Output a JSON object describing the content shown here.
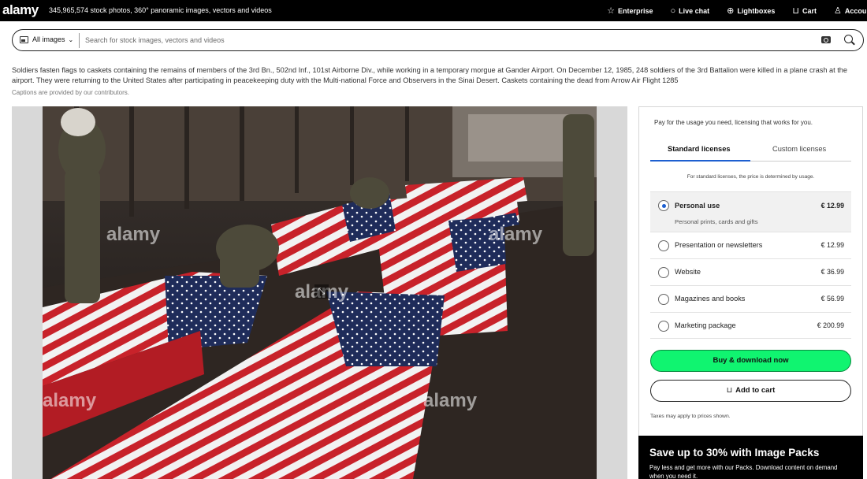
{
  "topbar": {
    "logo": "alamy",
    "stats": "345,965,574 stock photos, 360° panoramic images, vectors and videos",
    "nav": [
      {
        "label": "Enterprise",
        "icon": "star-icon"
      },
      {
        "label": "Live chat",
        "icon": "chat-icon"
      },
      {
        "label": "Lightboxes",
        "icon": "plus-circle-icon"
      },
      {
        "label": "Cart",
        "icon": "cart-icon"
      },
      {
        "label": "Account",
        "icon": "user-icon"
      }
    ]
  },
  "search": {
    "scope": "All images",
    "placeholder": "Search for stock images, vectors and videos"
  },
  "caption": {
    "text": "Soldiers fasten flags to caskets containing the remains of members of the 3rd Bn., 502nd Inf., 101st Airborne Div., while working in a temporary morgue at Gander Airport. On December 12, 1985, 248 soldiers of the 3rd Battalion were killed in a plane crash at the airport. They were returning to the United States after participating in peacekeeping duty with the Multi-national Force and Observers in the Sinai Desert. Caskets containing the dead from Arrow Air Flight 1285",
    "credit": "Captions are provided by our contributors."
  },
  "watermark": "alamy",
  "license": {
    "intro": "Pay for the usage you need, licensing that works for you.",
    "tabs": [
      "Standard licenses",
      "Custom licenses"
    ],
    "note": "For standard licenses, the price is determined by usage.",
    "options": [
      {
        "label": "Personal use",
        "sublabel": "Personal prints, cards and gifts",
        "price": "€ 12.99",
        "selected": true
      },
      {
        "label": "Presentation or newsletters",
        "price": "€ 12.99",
        "selected": false
      },
      {
        "label": "Website",
        "price": "€ 36.99",
        "selected": false
      },
      {
        "label": "Magazines and books",
        "price": "€ 56.99",
        "selected": false
      },
      {
        "label": "Marketing package",
        "price": "€ 200.99",
        "selected": false
      }
    ],
    "buy_label": "Buy & download now",
    "cart_label": "Add to cart",
    "taxes": "Taxes may apply to prices shown."
  },
  "promo": {
    "title": "Save up to 30% with Image Packs",
    "subtitle": "Pay less and get more with our Packs. Download content on demand when you need it."
  },
  "colors": {
    "accent": "#1d5fd0",
    "buy": "#10f470"
  }
}
